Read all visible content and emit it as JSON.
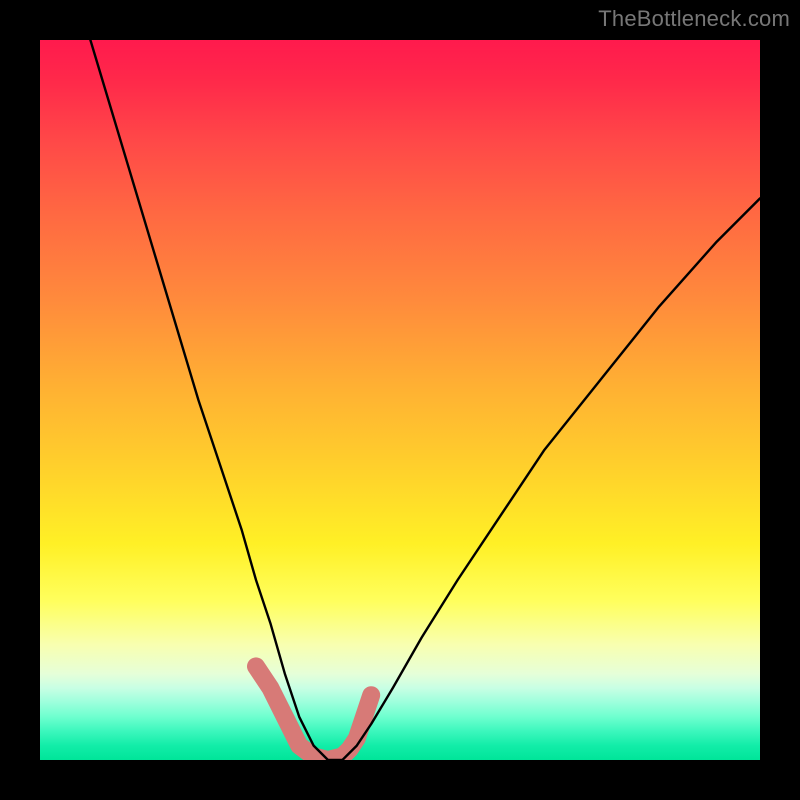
{
  "watermark": "TheBottleneck.com",
  "chart_data": {
    "type": "line",
    "title": "",
    "xlabel": "",
    "ylabel": "",
    "xlim": [
      0,
      100
    ],
    "ylim": [
      0,
      100
    ],
    "notes": "No axis ticks or numeric labels are visible; curve values are read as percentages of the plot area. y=0 is the bottom (green) and y=100 is the top (red). The black curve dips to y≈0 near x≈35–42 then rises toward the right. A secondary salmon highlight traces the trough region.",
    "series": [
      {
        "name": "bottleneck-curve",
        "color": "#000000",
        "x": [
          7,
          10,
          13,
          16,
          19,
          22,
          25,
          28,
          30,
          32,
          34,
          36,
          38,
          40,
          42,
          44,
          46,
          49,
          53,
          58,
          64,
          70,
          78,
          86,
          94,
          100
        ],
        "y": [
          100,
          90,
          80,
          70,
          60,
          50,
          41,
          32,
          25,
          19,
          12,
          6,
          2,
          0,
          0,
          2,
          5,
          10,
          17,
          25,
          34,
          43,
          53,
          63,
          72,
          78
        ]
      },
      {
        "name": "trough-highlight",
        "color": "#d77a77",
        "x": [
          30,
          32,
          34,
          35,
          36,
          38,
          40,
          42,
          43,
          44,
          45,
          46
        ],
        "y": [
          13,
          10,
          6,
          4,
          2,
          0.5,
          0,
          0.5,
          1.5,
          3,
          6,
          9
        ]
      }
    ],
    "background_gradient": {
      "orientation": "vertical",
      "stops": [
        {
          "pos": 0.0,
          "color": "#ff1a4d"
        },
        {
          "pos": 0.24,
          "color": "#ff6842"
        },
        {
          "pos": 0.48,
          "color": "#ffb033"
        },
        {
          "pos": 0.7,
          "color": "#fff026"
        },
        {
          "pos": 0.84,
          "color": "#f8ffb0"
        },
        {
          "pos": 0.92,
          "color": "#9cffdc"
        },
        {
          "pos": 1.0,
          "color": "#00e599"
        }
      ]
    }
  }
}
